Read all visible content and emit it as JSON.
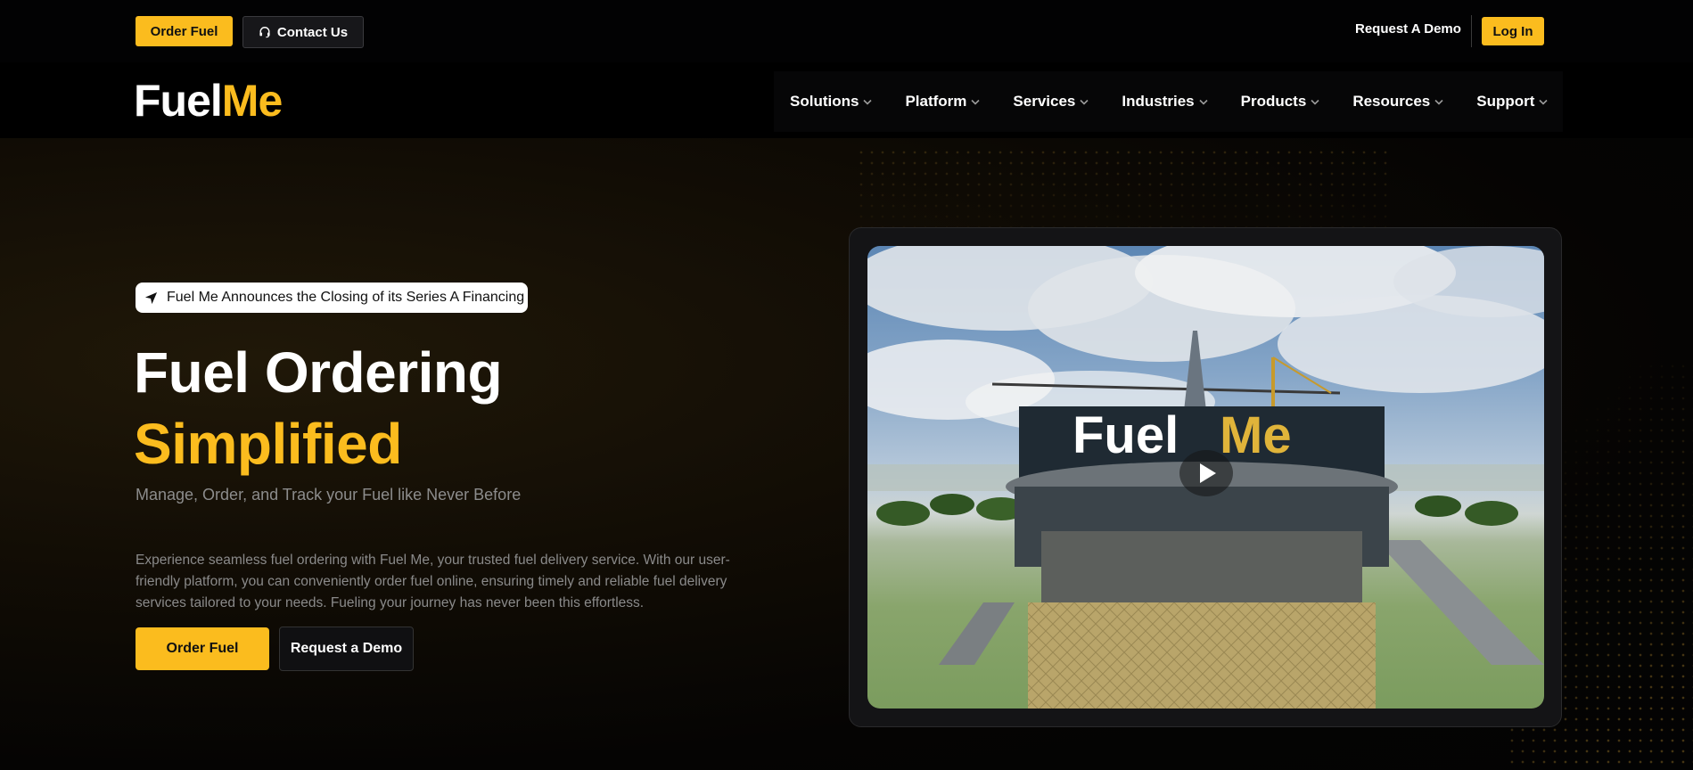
{
  "topbar": {
    "order_fuel": "Order Fuel",
    "contact_us": "Contact Us",
    "request_demo": "Request A Demo",
    "log_in": "Log In"
  },
  "logo": {
    "part1": "Fuel",
    "part2": "Me"
  },
  "nav": {
    "items": [
      {
        "label": "Solutions"
      },
      {
        "label": "Platform"
      },
      {
        "label": "Services"
      },
      {
        "label": "Industries"
      },
      {
        "label": "Products"
      },
      {
        "label": "Resources"
      },
      {
        "label": "Support"
      }
    ]
  },
  "hero": {
    "announcement": "Fuel Me Announces the Closing of its Series A Financing",
    "title_line1": "Fuel Ordering",
    "title_line2": "Simplified",
    "subtitle": "Manage, Order, and Track your Fuel like Never Before",
    "paragraph": "Experience seamless fuel ordering with Fuel Me, your trusted fuel delivery service. With our user-friendly platform, you can conveniently order fuel online, ensuring timely and reliable fuel delivery services tailored to your needs. Fueling your journey has never been this effortless.",
    "btn_order": "Order Fuel",
    "btn_demo": "Request a Demo"
  },
  "video": {
    "sign_part1": "Fuel",
    "sign_part2": "Me"
  },
  "colors": {
    "accent": "#fbbc1e",
    "background": "#000000",
    "muted_text": "#8a8a8a"
  },
  "icons": {
    "contact": "headset-icon",
    "announcement": "navigation-arrow-icon",
    "nav_dropdown": "chevron-down-icon",
    "video": "play-icon"
  }
}
